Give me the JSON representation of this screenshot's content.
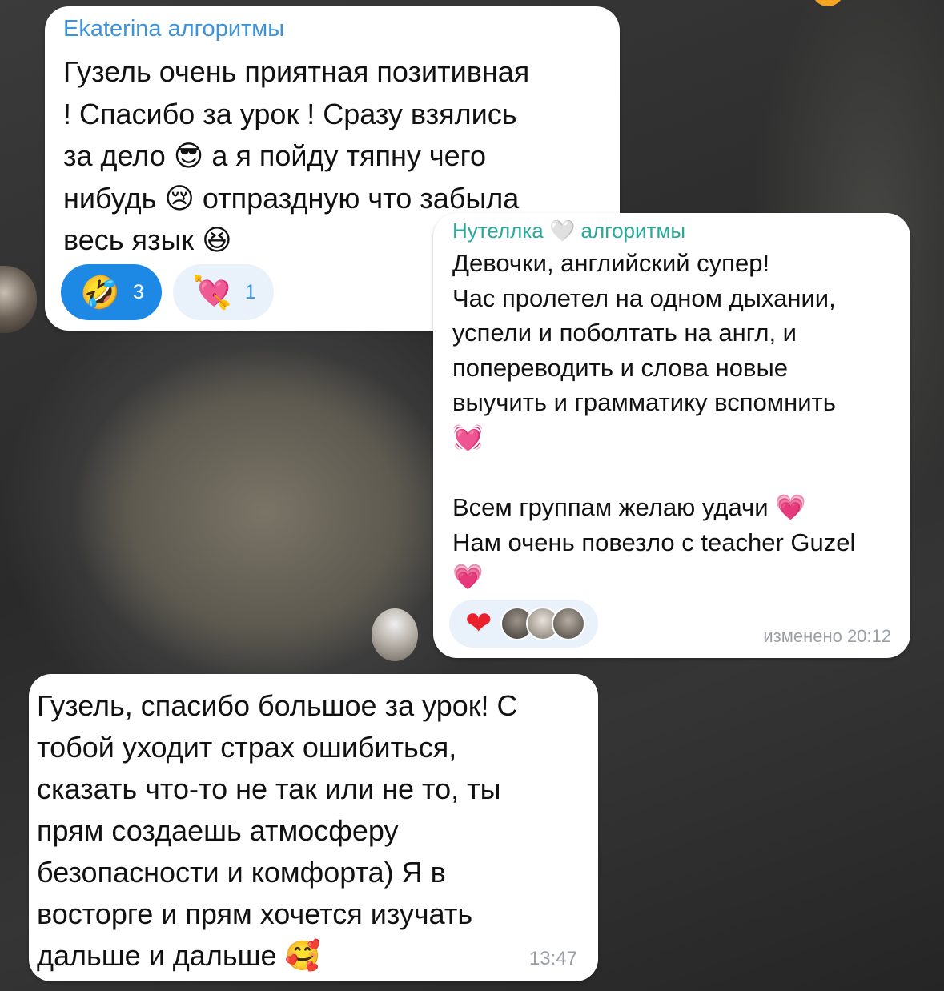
{
  "messages": [
    {
      "sender": "Ekaterina алгоритмы",
      "lines": [
        "Гузель очень приятная позитивная",
        "! Спасибо за урок ! Сразу взялись",
        "за дело 😎 а я пойду тяпну чего",
        "нибудь 😢 отпраздную что забыла",
        "весь язык 😆"
      ],
      "reactions": [
        {
          "emoji": "🤣",
          "count": "3"
        },
        {
          "emoji": "💘",
          "count": "1"
        }
      ],
      "sender_color": "#3d93d9"
    },
    {
      "sender": "Нутеллка 🤍 алгоритмы",
      "lines": [
        "Девочки, английский супер!",
        "Час пролетел на одном дыхании,",
        "успели и поболтать на англ, и",
        "попереводить и слова новые",
        "выучить и грамматику вспомнить",
        "💓",
        "",
        "Всем группам желаю удачи 💗",
        "Нам очень повезло с teacher Guzel",
        "💗"
      ],
      "reaction_emoji": "❤",
      "time": "изменено 20:12",
      "sender_color": "#28a99c"
    },
    {
      "lines": [
        "Гузель, спасибо большое за урок! С",
        "тобой уходит страх ошибиться,",
        "сказать что-то не так или не то, ты",
        "прям создаешь атмосферу",
        "безопасности и комфорта) Я в",
        "восторге и прям хочется изучать",
        "дальше и дальше 🥰"
      ],
      "time": "13:47"
    }
  ],
  "colors": {
    "bubble": "#ffffff",
    "reaction_mine": "#1e88e5",
    "reaction_other": "#e9f2fb",
    "time": "#9aa0a6"
  }
}
